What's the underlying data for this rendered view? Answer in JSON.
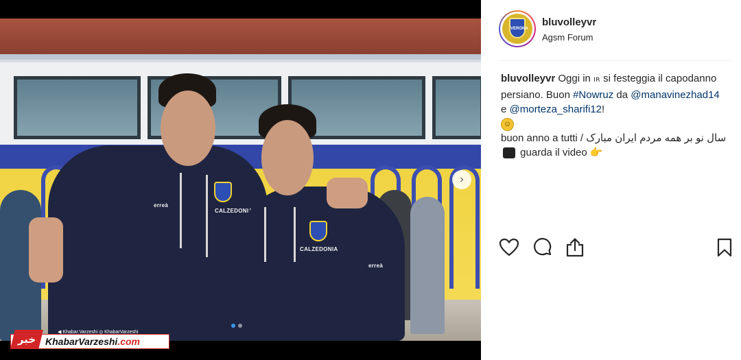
{
  "post": {
    "username": "bluvolleyvr",
    "location": "Agsm Forum",
    "avatar_text": "VERONA",
    "caption": {
      "user": "bluvolleyvr",
      "part1": " Oggi in ",
      "flag": "IR",
      "part2": " si festeggia il capodanno persiano. Buon ",
      "hashtag": "#Nowruz",
      "part3": " da ",
      "mention1": "@manavinezhad14",
      "part4": " e ",
      "mention2": "@morteza_sharifi12",
      "part5": "!",
      "smile_emoji": "☺",
      "line2_start": "buon anno a tutti / ",
      "persian_text": "سال نو بر همه مردم ایران مبارک",
      "line3_end": " guarda il video ",
      "point_emoji": "👉"
    }
  },
  "photo": {
    "next_arrow": "›",
    "shirt_brand": "CALZEDONIA",
    "shirt_maker": "erreà",
    "watermark_social": "◀ Khabar.Varzeshi  ◎ KhabarVarzeshi",
    "watermark_logo": "خبر",
    "watermark_name_a": "KhabarVarzeshi",
    "watermark_name_b": ".com"
  },
  "actions": {
    "like_icon": "heart-icon",
    "comment_icon": "comment-icon",
    "share_icon": "share-icon",
    "save_icon": "bookmark-icon"
  },
  "colors": {
    "link": "#003569",
    "carousel_active_dot": "#3897f0",
    "watermark_red": "#d32527"
  }
}
